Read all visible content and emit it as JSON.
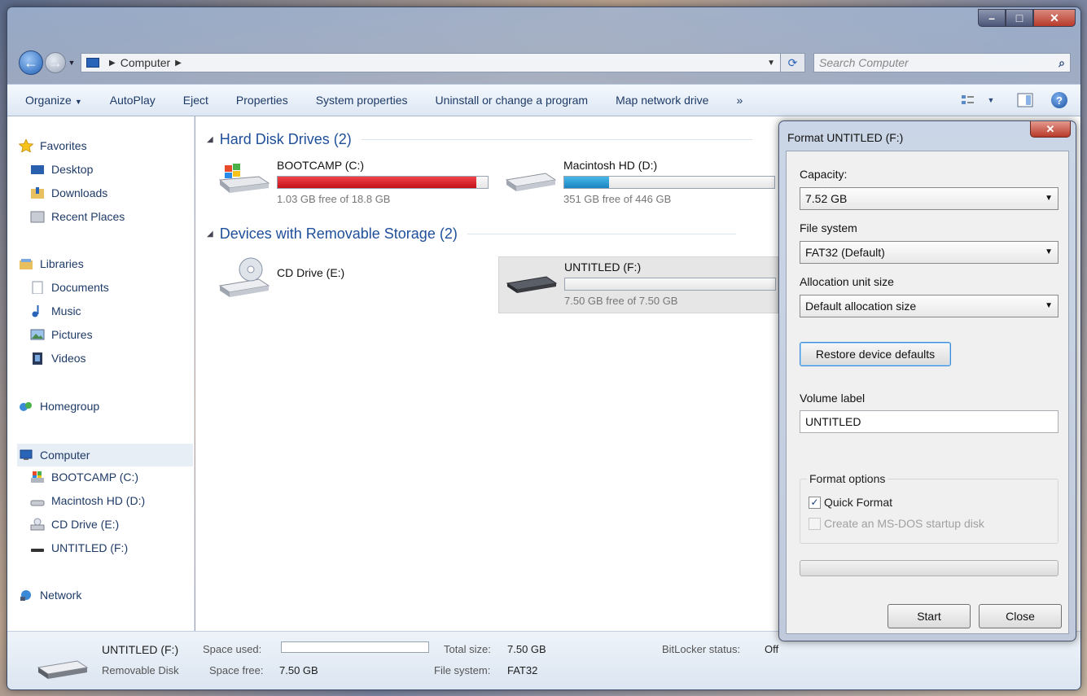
{
  "window": {
    "caption": {
      "minimize": "–",
      "maximize": "□",
      "close": "✕"
    }
  },
  "nav": {
    "back": "←",
    "forward": "→",
    "breadcrumb": "Computer",
    "search_placeholder": "Search Computer"
  },
  "toolbar": {
    "items": [
      "Organize",
      "AutoPlay",
      "Eject",
      "Properties",
      "System properties",
      "Uninstall or change a program",
      "Map network drive",
      "»"
    ]
  },
  "sidebar": {
    "favorites": "Favorites",
    "desktop": "Desktop",
    "downloads": "Downloads",
    "recent_places": "Recent Places",
    "libraries": "Libraries",
    "documents": "Documents",
    "music": "Music",
    "pictures": "Pictures",
    "videos": "Videos",
    "homegroup": "Homegroup",
    "computer": "Computer",
    "bootcamp": "BOOTCAMP (C:)",
    "macintosh": "Macintosh HD (D:)",
    "cddrive": "CD Drive (E:)",
    "untitled": "UNTITLED (F:)",
    "network": "Network"
  },
  "content": {
    "hdd_group": "Hard Disk Drives (2)",
    "removable_group": "Devices with Removable Storage (2)",
    "drives": {
      "bootcamp": {
        "name": "BOOTCAMP (C:)",
        "free_text": "1.03 GB free of 18.8 GB",
        "used_fraction": 0.945
      },
      "macintosh": {
        "name": "Macintosh HD (D:)",
        "free_text": "351 GB free of 446 GB",
        "used_fraction": 0.213
      },
      "cddrive": {
        "name": "CD Drive (E:)"
      },
      "untitled": {
        "name": "UNTITLED (F:)",
        "free_text": "7.50 GB free of 7.50 GB",
        "used_fraction": 0.0
      }
    }
  },
  "status": {
    "name": "UNTITLED (F:)",
    "type": "Removable Disk",
    "space_used_label": "Space used:",
    "space_free_label": "Space free:",
    "space_free_value": "7.50 GB",
    "total_size_label": "Total size:",
    "total_size_value": "7.50 GB",
    "file_system_label": "File system:",
    "file_system_value": "FAT32",
    "bitlocker_label": "BitLocker status:",
    "bitlocker_value": "Off"
  },
  "dialog": {
    "title": "Format UNTITLED (F:)",
    "close": "✕",
    "capacity_label": "Capacity:",
    "capacity_value": "7.52 GB",
    "filesystem_label": "File system",
    "filesystem_value": "FAT32 (Default)",
    "allocation_label": "Allocation unit size",
    "allocation_value": "Default allocation size",
    "restore_button": "Restore device defaults",
    "volume_label": "Volume label",
    "volume_value": "UNTITLED",
    "format_options": "Format options",
    "quick_format": "Quick Format",
    "quick_format_checked": true,
    "msdos": "Create an MS-DOS startup disk",
    "progress": 0.0,
    "start": "Start",
    "close_button": "Close"
  }
}
